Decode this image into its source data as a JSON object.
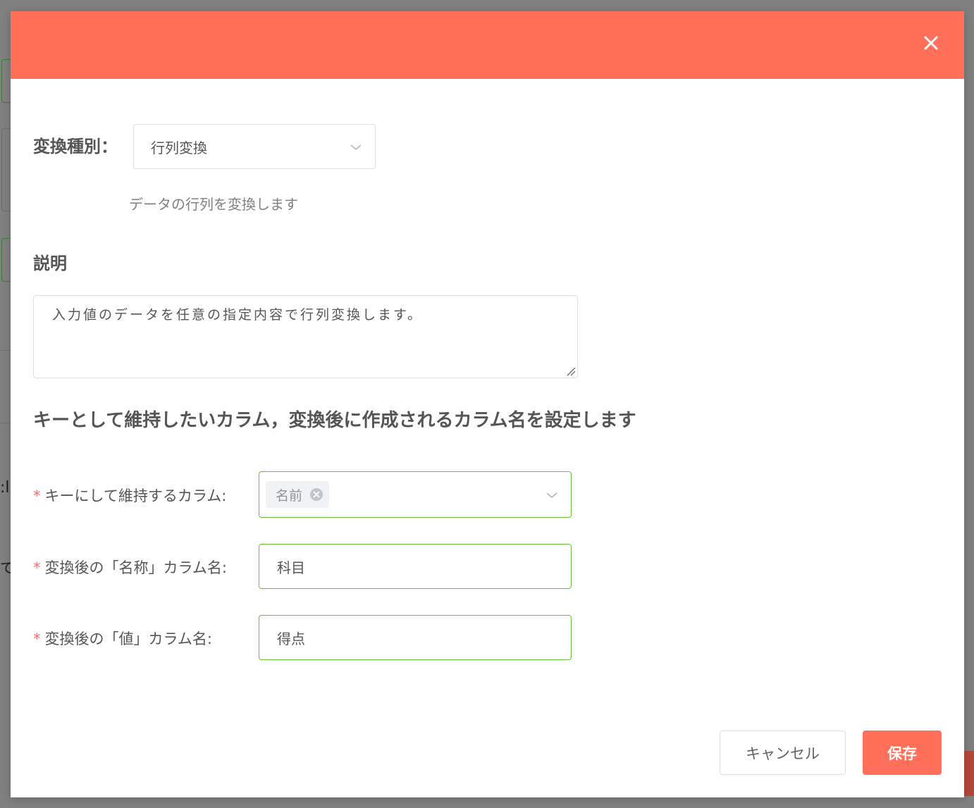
{
  "background": {
    "fragment_text_1": ":l",
    "fragment_text_2": "て"
  },
  "dialog": {
    "header_color": "#ff6f5a",
    "close_icon": "close-icon",
    "type_label": "変換種別：",
    "type_select": {
      "value": "行列変換",
      "icon": "chevron-down-icon"
    },
    "type_description": "データの行列を変換します",
    "description_label": "説明",
    "description_text": "入力値のデータを任意の指定内容で行列変換します。",
    "subheading": "キーとして維持したいカラム，変換後に作成されるカラム名を設定します",
    "form": {
      "required_mark": "*",
      "key_column": {
        "label": "キーにして維持するカラム:",
        "tags": [
          "名前"
        ]
      },
      "name_column": {
        "label": "変換後の「名称」カラム名:",
        "value": "科目"
      },
      "value_column": {
        "label": "変換後の「値」カラム名:",
        "value": "得点"
      }
    },
    "buttons": {
      "cancel": "キャンセル",
      "save": "保存"
    },
    "colors": {
      "accent": "#ff6f5a",
      "valid_border": "#67c23a",
      "required": "#f56c6c"
    }
  }
}
